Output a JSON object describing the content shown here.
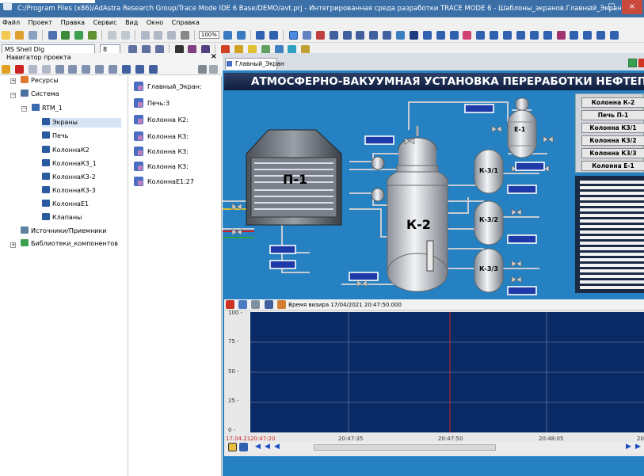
{
  "window": {
    "title": "C:/Program Files (x86)/AdAstra Research Group/Trace Mode IDE 6 Base/DEMO/avt.prj - Интегрированная среда разработки TRACE MODE 6 - Шаблоны_экранов.Главный_Экран",
    "min": "–",
    "max": "□",
    "close": "×"
  },
  "menu": [
    "Файл",
    "Проект",
    "Правка",
    "Сервис",
    "Вид",
    "Окно",
    "Справка"
  ],
  "toolbar": {
    "zoom": "100%",
    "font": "MS Shell Dlg",
    "size": "8"
  },
  "navigator": {
    "title": "Навигатор проекта",
    "close": "×"
  },
  "tree": [
    {
      "label": "Ресурсы",
      "level": 0,
      "expander": "+"
    },
    {
      "label": "Система",
      "level": 0,
      "expander": "−"
    },
    {
      "label": "RTM_1",
      "level": 1,
      "expander": "−"
    },
    {
      "label": "Экраны",
      "level": 2,
      "selected": true
    },
    {
      "label": "Печь",
      "level": 2
    },
    {
      "label": "КолоннаК2",
      "level": 2
    },
    {
      "label": "КолоннаК3_1",
      "level": 2
    },
    {
      "label": "КолоннаК3-2",
      "level": 2
    },
    {
      "label": "КолоннаК3-3",
      "level": 2
    },
    {
      "label": "КолоннаЕ1",
      "level": 2
    },
    {
      "label": "Клапаны",
      "level": 2
    },
    {
      "label": "Источники/Приемники",
      "level": 0
    },
    {
      "label": "Библиотеки_компонентов",
      "level": 0,
      "expander": "+"
    }
  ],
  "list": [
    "Главный_Экран:",
    "Печь:3",
    "Колонна К2:",
    "Колонна К3:",
    "Колонна К3:",
    "Колонна К3:",
    "КолоннаЕ1:27"
  ],
  "tab": {
    "label": "Главный_Экран"
  },
  "screen": {
    "banner": "АТМОСФЕРНО-ВАКУУМНАЯ УСТАНОВКА ПЕРЕРАБОТКИ НЕФТЕПРОДУКТОВ",
    "furnace": "П-1",
    "column": "К-2",
    "e1": "Е-1",
    "k31": "К-3/1",
    "k32": "К-3/2",
    "k33": "К-3/3",
    "buttons": [
      "Колонна К-2",
      "Печь П-1",
      "Колонна К3/1",
      "Колонна К3/2",
      "Колонна К3/3",
      "Колонна Е-1"
    ]
  },
  "trend": {
    "time_label": "Время визира 17/04/2021 20:47:50.000",
    "y_ticks": [
      "100 -",
      "75 -",
      "50 -",
      "25 -",
      "0 -"
    ],
    "x_start_date": "17.04.21",
    "x_start_time": "20:47:20",
    "x_ticks": [
      "20:47:35",
      "20:47:50",
      "20:48:05",
      "20"
    ]
  },
  "colors": {
    "title_bar": "#3a6fa8",
    "canvas": "#2581c2",
    "trend_bg": "#0a2a66",
    "accent_red": "#cc2222"
  }
}
